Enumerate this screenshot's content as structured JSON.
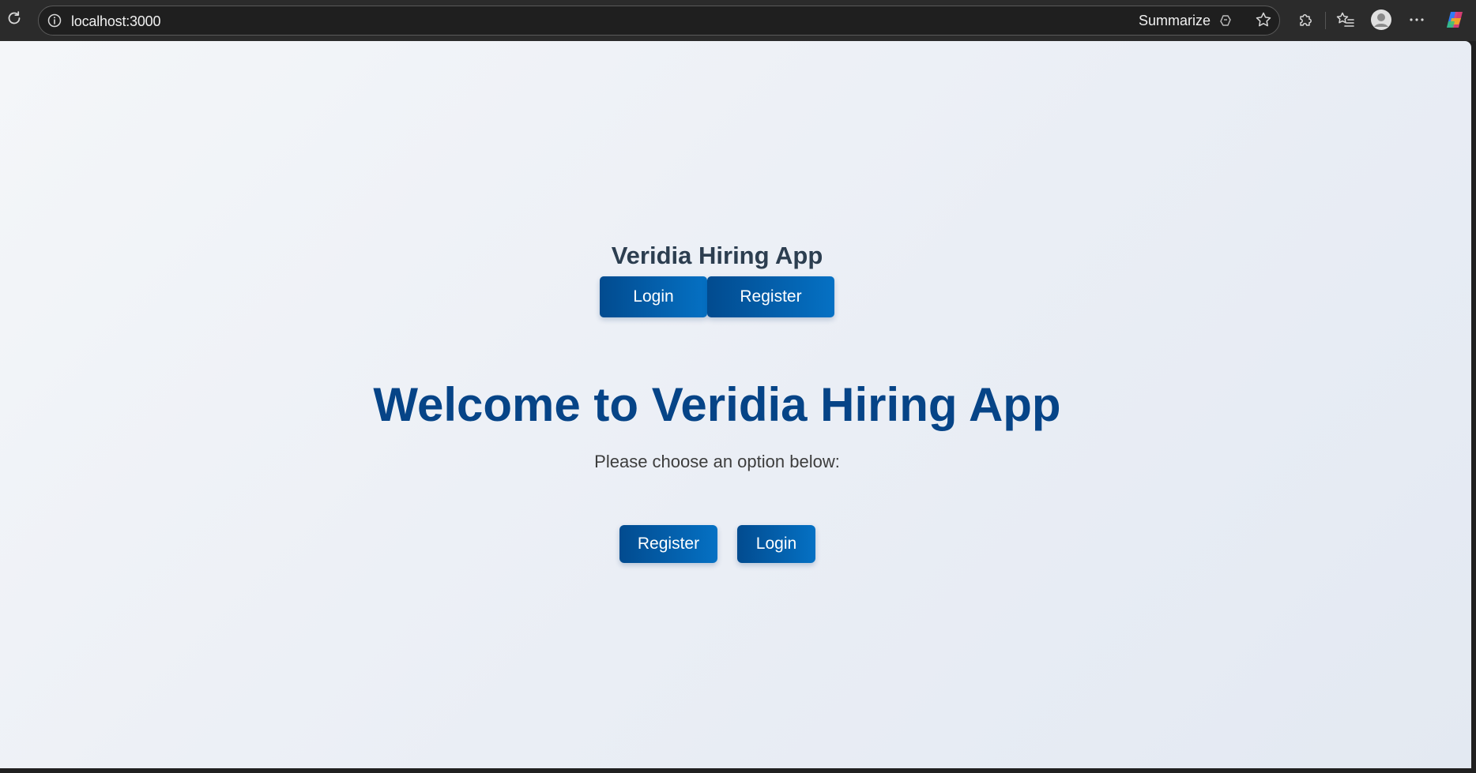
{
  "browser": {
    "url": "localhost:3000",
    "summarize_label": "Summarize"
  },
  "app": {
    "title": "Veridia Hiring App",
    "nav": {
      "login_label": "Login",
      "register_label": "Register"
    },
    "welcome_heading": "Welcome to Veridia Hiring App",
    "subtitle": "Please choose an option below:",
    "actions": {
      "register_label": "Register",
      "login_label": "Login"
    }
  },
  "colors": {
    "primary_button_start": "#024b8f",
    "primary_button_end": "#0571c4",
    "heading": "#064487",
    "title": "#2c3e50"
  }
}
